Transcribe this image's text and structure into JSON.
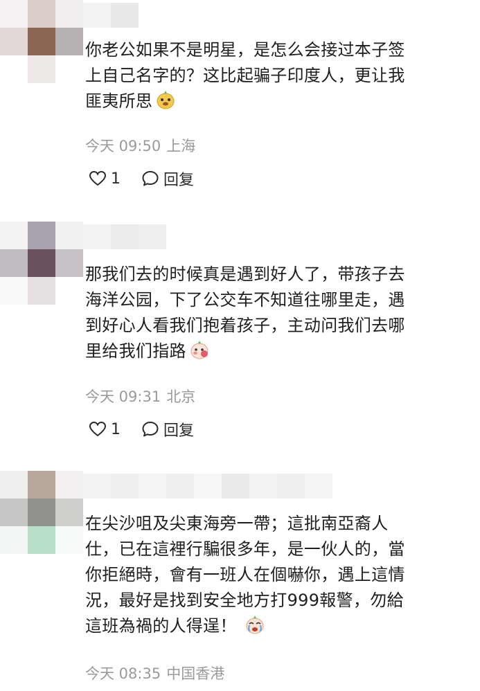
{
  "comments": [
    {
      "lines": [
        "你老公如果不是明星，是怎么会接过本子签",
        "上自己名字的？这比起骗子印度人，更让我",
        "匪夷所思"
      ],
      "emoji": "doge-face-emoji",
      "time": "今天 09:50",
      "location": "上海",
      "likes": "1",
      "reply_label": "回复"
    },
    {
      "lines": [
        "那我们去的时候真是遇到好人了，带孩子去",
        "海洋公园，下了公交车不知道往哪里走，遇",
        "到好心人看我们抱着孩子，主动问我们去哪",
        "里给我们指路"
      ],
      "emoji": "blush-face-emoji",
      "time": "今天 09:31",
      "location": "北京",
      "likes": "1",
      "reply_label": "回复"
    },
    {
      "lines": [
        "在尖沙咀及尖東海旁一帶；這批南亞裔人",
        "仕，已在這裡行騙很多年，是一伙人的，當",
        "你拒絕時，會有一班人在個嚇你，遇上這情",
        "況，最好是找到安全地方打999報警，勿給",
        "這班為禍的人得逞！"
      ],
      "emoji": "crying-face-emoji",
      "time": "今天 08:35",
      "location": "中国香港"
    }
  ]
}
